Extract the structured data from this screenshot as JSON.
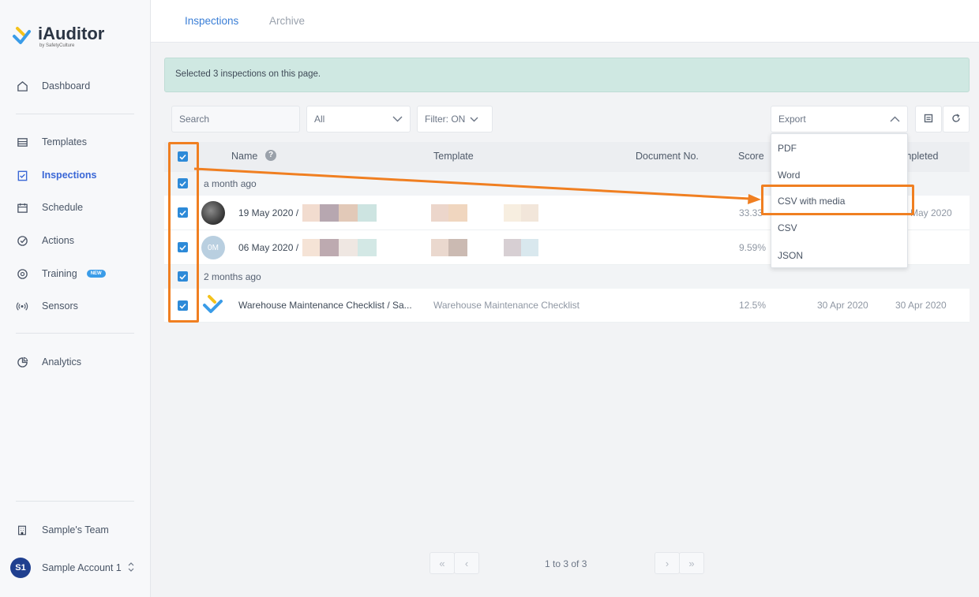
{
  "app": {
    "name": "iAuditor",
    "byline": "by SafetyCulture"
  },
  "sidebar": {
    "items": [
      {
        "label": "Dashboard"
      },
      {
        "label": "Templates"
      },
      {
        "label": "Inspections"
      },
      {
        "label": "Schedule"
      },
      {
        "label": "Actions"
      },
      {
        "label": "Training",
        "badge": "NEW"
      },
      {
        "label": "Sensors"
      },
      {
        "label": "Analytics"
      }
    ],
    "team": "Sample's Team",
    "account": {
      "initials": "S1",
      "name": "Sample Account 1"
    }
  },
  "tabs": [
    {
      "label": "Inspections"
    },
    {
      "label": "Archive"
    }
  ],
  "banner": "Selected 3 inspections on this page.",
  "filters": {
    "search_placeholder": "Search",
    "all_select": "All",
    "filter_toggle": "Filter: ON",
    "export_select": "Export"
  },
  "table": {
    "headers": {
      "name": "Name",
      "template": "Template",
      "document": "Document No.",
      "score": "Score",
      "completed": "mpleted"
    },
    "groups": [
      "a month ago",
      "2 months ago"
    ],
    "rows": [
      {
        "name": "19 May 2020 /",
        "template": "",
        "score": "33.33",
        "date_completed": "May 2020"
      },
      {
        "avatar": "0M",
        "name": "06 May 2020 /",
        "template": "",
        "score": "9.59%",
        "date_completed": ""
      },
      {
        "name": "Warehouse Maintenance Checklist / Sa...",
        "template": "Warehouse Maintenance Checklist",
        "score": "12.5%",
        "date_modified": "30 Apr 2020",
        "date_completed": "30 Apr 2020"
      }
    ]
  },
  "export_menu": [
    "PDF",
    "Word",
    "CSV with media",
    "CSV",
    "JSON"
  ],
  "pagination": {
    "text": "1 to 3 of 3"
  },
  "colors": {
    "accent": "#3a67d6",
    "checkbox": "#2d8ad8",
    "highlight": "#f07f21",
    "banner": "#cfe8e2"
  }
}
